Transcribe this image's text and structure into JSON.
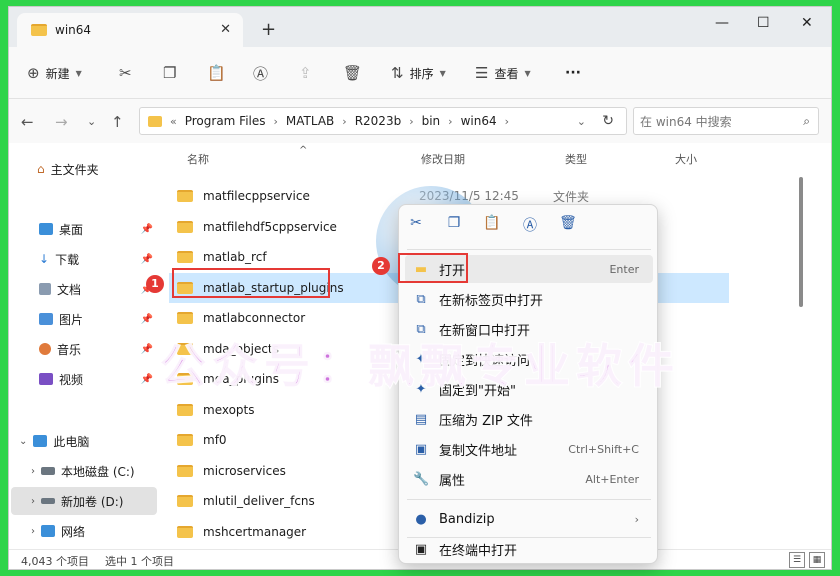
{
  "tab": {
    "title": "win64"
  },
  "toolbar": {
    "new_label": "新建",
    "sort_label": "排序",
    "view_label": "查看",
    "more": "···"
  },
  "address": {
    "crumbs": [
      "Program Files",
      "MATLAB",
      "R2023b",
      "bin",
      "win64"
    ],
    "overflow": "«"
  },
  "search": {
    "placeholder": "在 win64 中搜索"
  },
  "sidebar": {
    "home": "主文件夹",
    "quick": [
      "桌面",
      "下载",
      "文档",
      "图片",
      "音乐",
      "视频"
    ],
    "thispc": "此电脑",
    "drives": [
      "本地磁盘 (C:)",
      "新加卷 (D:)"
    ],
    "network": "网络"
  },
  "columns": {
    "name": "名称",
    "date": "修改日期",
    "type": "类型",
    "size": "大小"
  },
  "files": [
    {
      "name": "matfilecppservice",
      "date": "2023/11/5 12:45",
      "type": "文件夹"
    },
    {
      "name": "matfilehdf5cppservice",
      "date": "",
      "type": ""
    },
    {
      "name": "matlab_rcf",
      "date": "",
      "type": ""
    },
    {
      "name": "matlab_startup_plugins",
      "date": "",
      "type": ""
    },
    {
      "name": "matlabconnector",
      "date": "",
      "type": ""
    },
    {
      "name": "mda_objects",
      "date": "",
      "type": ""
    },
    {
      "name": "mda_plugins",
      "date": "",
      "type": ""
    },
    {
      "name": "mexopts",
      "date": "",
      "type": ""
    },
    {
      "name": "mf0",
      "date": "",
      "type": ""
    },
    {
      "name": "microservices",
      "date": "",
      "type": ""
    },
    {
      "name": "mlutil_deliver_fcns",
      "date": "",
      "type": ""
    },
    {
      "name": "mshcertmanager",
      "date": "",
      "type": ""
    }
  ],
  "status": {
    "count": "4,043 个项目",
    "selected": "选中 1 个项目"
  },
  "context_menu": {
    "items": [
      {
        "label": "打开",
        "shortcut": "Enter"
      },
      {
        "label": "在新标签页中打开",
        "shortcut": ""
      },
      {
        "label": "在新窗口中打开",
        "shortcut": ""
      },
      {
        "label": "固定到快速访问",
        "shortcut": ""
      },
      {
        "label": "固定到\"开始\"",
        "shortcut": ""
      },
      {
        "label": "压缩为 ZIP 文件",
        "shortcut": ""
      },
      {
        "label": "复制文件地址",
        "shortcut": "Ctrl+Shift+C"
      },
      {
        "label": "属性",
        "shortcut": "Alt+Enter"
      },
      {
        "label": "Bandizip",
        "shortcut": ""
      },
      {
        "label": "在终端中打开",
        "shortcut": ""
      }
    ]
  },
  "callouts": {
    "one": "1",
    "two": "2"
  },
  "watermark": "公众号：飘飘专业软件"
}
